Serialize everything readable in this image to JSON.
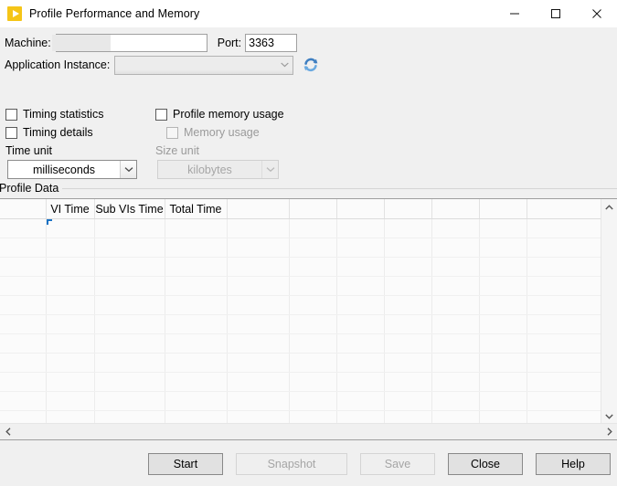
{
  "window": {
    "title": "Profile Performance and Memory",
    "app_icon": "labview-play-icon",
    "accent_color": "#f5c518",
    "titlebar_bg": "#ffffff",
    "dialog_bg": "#f0f0f0",
    "controls": {
      "minimize": "minimize-icon",
      "maximize": "maximize-icon",
      "close": "close-icon"
    }
  },
  "form": {
    "machine_label": "Machine:",
    "machine_value": "",
    "machine_placeholder": "",
    "port_label": "Port:",
    "port_value": "3363",
    "app_instance_label": "Application Instance:",
    "app_instance_value": "",
    "refresh_icon": "refresh-icon"
  },
  "options": {
    "timing_statistics": {
      "label": "Timing statistics",
      "checked": false,
      "enabled": true
    },
    "timing_details": {
      "label": "Timing details",
      "checked": false,
      "enabled": true
    },
    "profile_memory_usage": {
      "label": "Profile memory usage",
      "checked": false,
      "enabled": true
    },
    "memory_usage": {
      "label": "Memory usage",
      "checked": false,
      "enabled": false
    }
  },
  "units": {
    "time_unit_label": "Time unit",
    "time_unit_value": "milliseconds",
    "size_unit_label": "Size unit",
    "size_unit_value": "kilobytes"
  },
  "profile_data": {
    "section_label": "Profile Data",
    "columns": [
      "",
      "VI Time",
      "Sub VIs Time",
      "Total Time",
      "",
      "",
      "",
      "",
      "",
      "",
      ""
    ],
    "rows": [],
    "row_count_visible": 12,
    "selected_cell": {
      "row": 0,
      "column": 1
    },
    "vscroll_up_icon": "chevron-up-icon",
    "vscroll_down_icon": "chevron-down-icon",
    "hscroll_left_icon": "chevron-left-icon",
    "hscroll_right_icon": "chevron-right-icon"
  },
  "buttons": {
    "start": {
      "label": "Start",
      "enabled": true
    },
    "snapshot": {
      "label": "Snapshot",
      "enabled": false
    },
    "save": {
      "label": "Save",
      "enabled": false
    },
    "close": {
      "label": "Close",
      "enabled": true
    },
    "help": {
      "label": "Help",
      "enabled": true
    }
  }
}
